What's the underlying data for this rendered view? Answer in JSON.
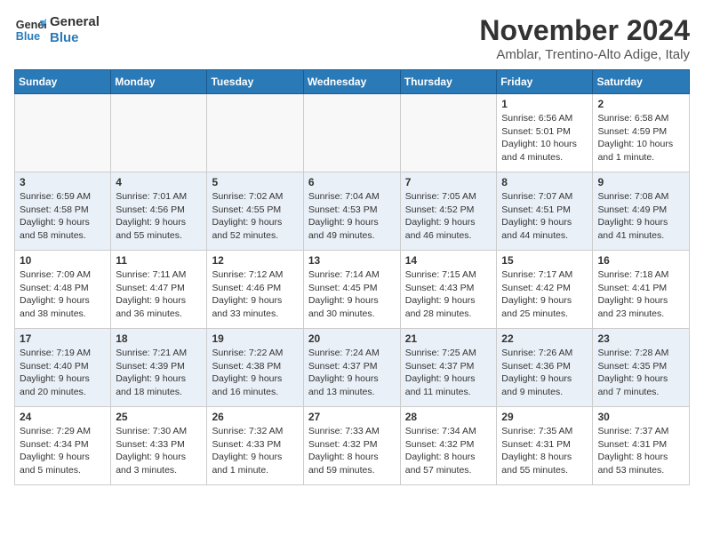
{
  "logo": {
    "line1": "General",
    "line2": "Blue"
  },
  "title": "November 2024",
  "subtitle": "Amblar, Trentino-Alto Adige, Italy",
  "headers": [
    "Sunday",
    "Monday",
    "Tuesday",
    "Wednesday",
    "Thursday",
    "Friday",
    "Saturday"
  ],
  "weeks": [
    [
      {
        "day": "",
        "detail": ""
      },
      {
        "day": "",
        "detail": ""
      },
      {
        "day": "",
        "detail": ""
      },
      {
        "day": "",
        "detail": ""
      },
      {
        "day": "",
        "detail": ""
      },
      {
        "day": "1",
        "detail": "Sunrise: 6:56 AM\nSunset: 5:01 PM\nDaylight: 10 hours\nand 4 minutes."
      },
      {
        "day": "2",
        "detail": "Sunrise: 6:58 AM\nSunset: 4:59 PM\nDaylight: 10 hours\nand 1 minute."
      }
    ],
    [
      {
        "day": "3",
        "detail": "Sunrise: 6:59 AM\nSunset: 4:58 PM\nDaylight: 9 hours\nand 58 minutes."
      },
      {
        "day": "4",
        "detail": "Sunrise: 7:01 AM\nSunset: 4:56 PM\nDaylight: 9 hours\nand 55 minutes."
      },
      {
        "day": "5",
        "detail": "Sunrise: 7:02 AM\nSunset: 4:55 PM\nDaylight: 9 hours\nand 52 minutes."
      },
      {
        "day": "6",
        "detail": "Sunrise: 7:04 AM\nSunset: 4:53 PM\nDaylight: 9 hours\nand 49 minutes."
      },
      {
        "day": "7",
        "detail": "Sunrise: 7:05 AM\nSunset: 4:52 PM\nDaylight: 9 hours\nand 46 minutes."
      },
      {
        "day": "8",
        "detail": "Sunrise: 7:07 AM\nSunset: 4:51 PM\nDaylight: 9 hours\nand 44 minutes."
      },
      {
        "day": "9",
        "detail": "Sunrise: 7:08 AM\nSunset: 4:49 PM\nDaylight: 9 hours\nand 41 minutes."
      }
    ],
    [
      {
        "day": "10",
        "detail": "Sunrise: 7:09 AM\nSunset: 4:48 PM\nDaylight: 9 hours\nand 38 minutes."
      },
      {
        "day": "11",
        "detail": "Sunrise: 7:11 AM\nSunset: 4:47 PM\nDaylight: 9 hours\nand 36 minutes."
      },
      {
        "day": "12",
        "detail": "Sunrise: 7:12 AM\nSunset: 4:46 PM\nDaylight: 9 hours\nand 33 minutes."
      },
      {
        "day": "13",
        "detail": "Sunrise: 7:14 AM\nSunset: 4:45 PM\nDaylight: 9 hours\nand 30 minutes."
      },
      {
        "day": "14",
        "detail": "Sunrise: 7:15 AM\nSunset: 4:43 PM\nDaylight: 9 hours\nand 28 minutes."
      },
      {
        "day": "15",
        "detail": "Sunrise: 7:17 AM\nSunset: 4:42 PM\nDaylight: 9 hours\nand 25 minutes."
      },
      {
        "day": "16",
        "detail": "Sunrise: 7:18 AM\nSunset: 4:41 PM\nDaylight: 9 hours\nand 23 minutes."
      }
    ],
    [
      {
        "day": "17",
        "detail": "Sunrise: 7:19 AM\nSunset: 4:40 PM\nDaylight: 9 hours\nand 20 minutes."
      },
      {
        "day": "18",
        "detail": "Sunrise: 7:21 AM\nSunset: 4:39 PM\nDaylight: 9 hours\nand 18 minutes."
      },
      {
        "day": "19",
        "detail": "Sunrise: 7:22 AM\nSunset: 4:38 PM\nDaylight: 9 hours\nand 16 minutes."
      },
      {
        "day": "20",
        "detail": "Sunrise: 7:24 AM\nSunset: 4:37 PM\nDaylight: 9 hours\nand 13 minutes."
      },
      {
        "day": "21",
        "detail": "Sunrise: 7:25 AM\nSunset: 4:37 PM\nDaylight: 9 hours\nand 11 minutes."
      },
      {
        "day": "22",
        "detail": "Sunrise: 7:26 AM\nSunset: 4:36 PM\nDaylight: 9 hours\nand 9 minutes."
      },
      {
        "day": "23",
        "detail": "Sunrise: 7:28 AM\nSunset: 4:35 PM\nDaylight: 9 hours\nand 7 minutes."
      }
    ],
    [
      {
        "day": "24",
        "detail": "Sunrise: 7:29 AM\nSunset: 4:34 PM\nDaylight: 9 hours\nand 5 minutes."
      },
      {
        "day": "25",
        "detail": "Sunrise: 7:30 AM\nSunset: 4:33 PM\nDaylight: 9 hours\nand 3 minutes."
      },
      {
        "day": "26",
        "detail": "Sunrise: 7:32 AM\nSunset: 4:33 PM\nDaylight: 9 hours\nand 1 minute."
      },
      {
        "day": "27",
        "detail": "Sunrise: 7:33 AM\nSunset: 4:32 PM\nDaylight: 8 hours\nand 59 minutes."
      },
      {
        "day": "28",
        "detail": "Sunrise: 7:34 AM\nSunset: 4:32 PM\nDaylight: 8 hours\nand 57 minutes."
      },
      {
        "day": "29",
        "detail": "Sunrise: 7:35 AM\nSunset: 4:31 PM\nDaylight: 8 hours\nand 55 minutes."
      },
      {
        "day": "30",
        "detail": "Sunrise: 7:37 AM\nSunset: 4:31 PM\nDaylight: 8 hours\nand 53 minutes."
      }
    ]
  ]
}
